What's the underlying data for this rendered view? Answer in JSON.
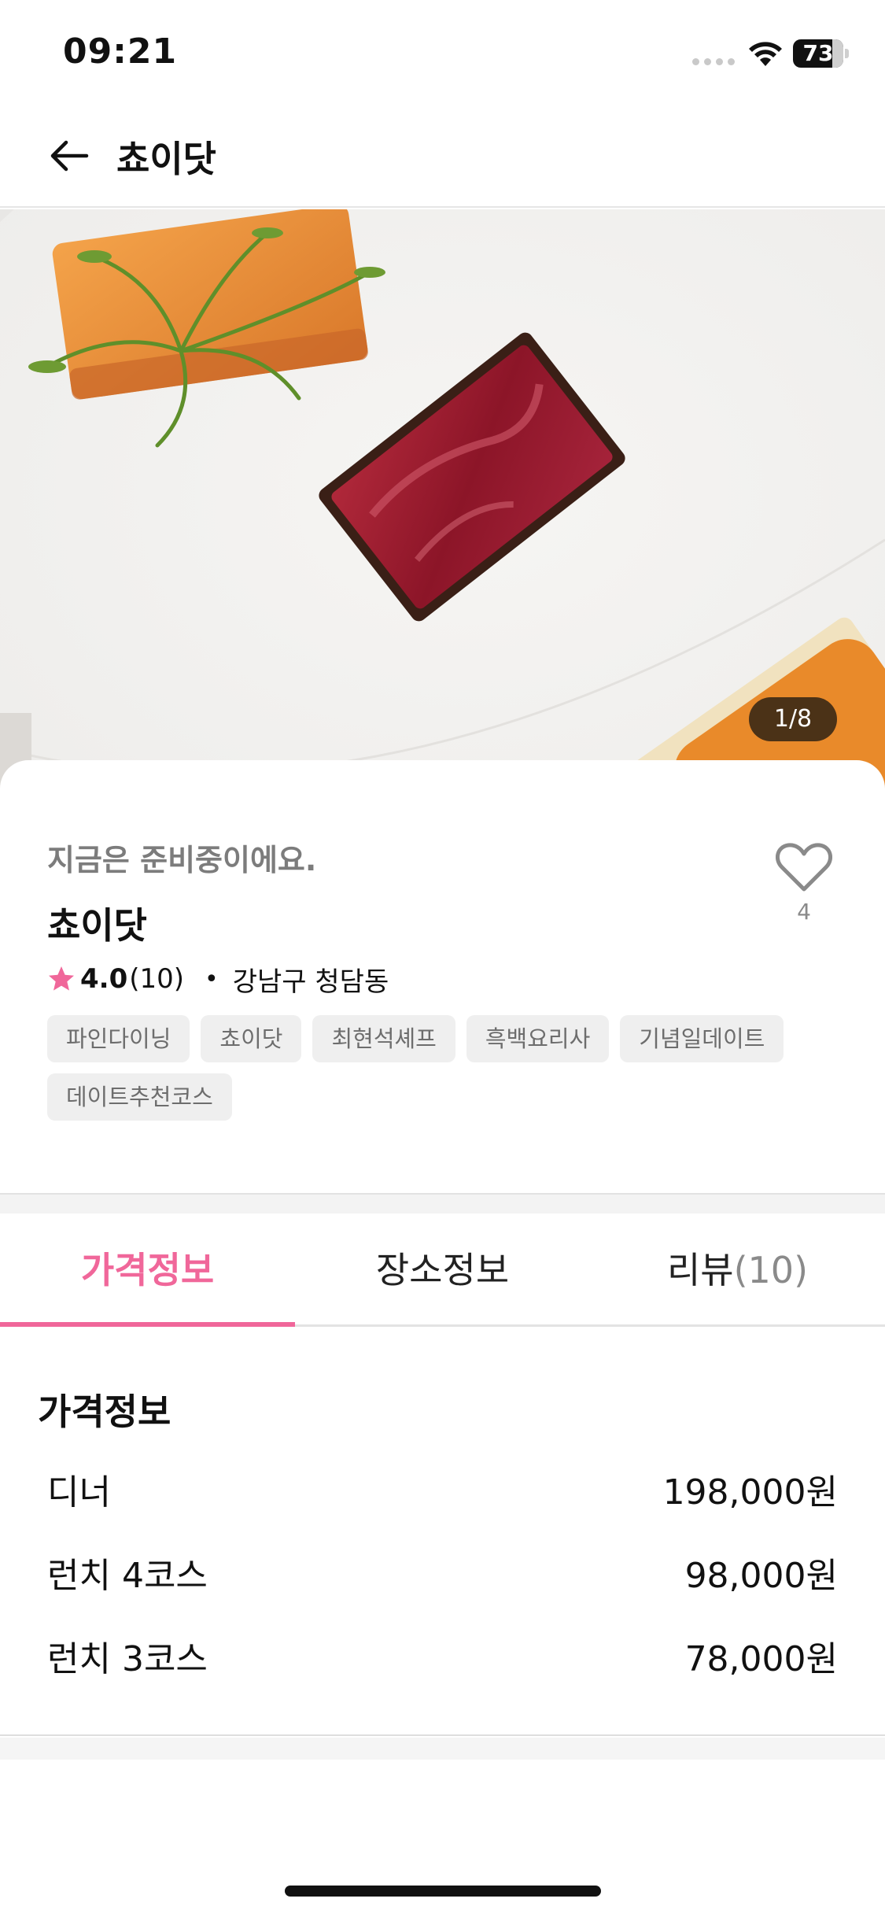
{
  "status_bar": {
    "time": "09:21",
    "battery_level": "73",
    "icons": [
      "cellular-signal-icon",
      "wifi-icon",
      "battery-icon"
    ]
  },
  "header": {
    "title": "쵸이닷",
    "back_icon": "arrow-left-icon"
  },
  "hero": {
    "photo_counter": "1/8",
    "current_photo": 1,
    "total_photos": 8
  },
  "info": {
    "status_text": "지금은 준비중이에요.",
    "name": "쵸이닷",
    "like_count": "4",
    "rating": "4.0",
    "review_count_text": "(10)",
    "separator": "•",
    "location": "강남구 청담동",
    "tags": [
      "파인다이닝",
      "쵸이닷",
      "최현석셰프",
      "흑백요리사",
      "기념일데이트",
      "데이트추천코스"
    ]
  },
  "tabs": {
    "items": [
      {
        "label": "가격정보",
        "count": ""
      },
      {
        "label": "장소정보",
        "count": ""
      },
      {
        "label": "리뷰",
        "count": "(10)"
      }
    ],
    "active_index": 0
  },
  "price": {
    "title": "가격정보",
    "rows": [
      {
        "name": "디너",
        "value": "198,000원"
      },
      {
        "name": "런치 4코스",
        "value": "98,000원"
      },
      {
        "name": "런치 3코스",
        "value": "78,000원"
      }
    ]
  },
  "colors": {
    "accent": "#f0679a",
    "text_primary": "#111111",
    "text_secondary": "#7c7c7c",
    "tag_background": "#efefef",
    "star": "#f0679a"
  }
}
